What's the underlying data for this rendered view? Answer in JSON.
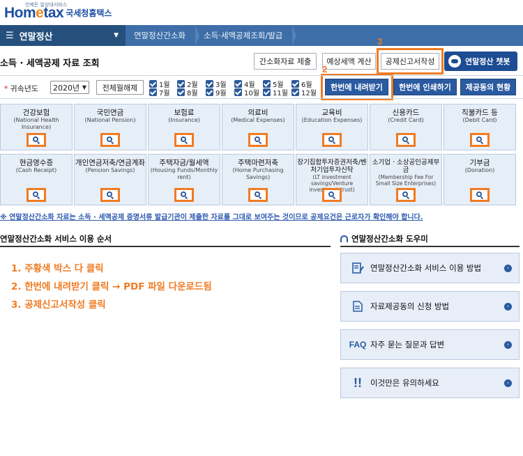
{
  "header": {
    "logo_sub": "언제든 알상대서비스",
    "logo_brand_a": "Hom",
    "logo_brand_e": "e",
    "logo_brand_b": "tax",
    "logo_kr": "국세청홈택스"
  },
  "nav": {
    "menu_label": "연말정산",
    "crumbs": [
      "연말정산간소화",
      "소득·세액공제조회/발급"
    ]
  },
  "page": {
    "title": "소득 · 세액공제 자료 조회",
    "buttons": {
      "simplified_submit": "간소화자료 제출",
      "tax_estimate": "예상세액 계산",
      "deduction_form": "공제신고서작성",
      "chatbot": "연말정산 챗봇"
    }
  },
  "annotations": {
    "n2": "2",
    "n3": "3"
  },
  "filter": {
    "label": "귀속년도",
    "year": "2020년",
    "clear_all": "전체월해제",
    "months": [
      "1월",
      "2월",
      "3월",
      "4월",
      "5월",
      "6월",
      "7월",
      "8월",
      "9월",
      "10월",
      "11월",
      "12월"
    ],
    "download_all": "한번에 내려받기",
    "print_all": "한번에 인쇄하기",
    "provider_status": "제공동의 현황"
  },
  "categories": [
    {
      "name": "건강보험",
      "en": "(National Health Insurance)"
    },
    {
      "name": "국민연금",
      "en": "(National Pension)"
    },
    {
      "name": "보험료",
      "en": "(Insurance)"
    },
    {
      "name": "의료비",
      "en": "(Medical Expenses)"
    },
    {
      "name": "교육비",
      "en": "(Education Expenses)"
    },
    {
      "name": "신용카드",
      "en": "(Credit Card)"
    },
    {
      "name": "직불카드 등",
      "en": "(Debit Card)"
    },
    {
      "name": "현금영수증",
      "en": "(Cash Receipt)"
    },
    {
      "name": "개인연금저축/연금계좌",
      "en": "(Pension Savings)"
    },
    {
      "name": "주택자금/월세액",
      "en": "(Housing Funds/Monthly rent)"
    },
    {
      "name": "주택마련저축",
      "en": "(Home Purchasing Savings)"
    },
    {
      "name": "장기집합투자증권저축/벤처기업투자신탁",
      "en": "(LT investment savings/Venture investment trust)"
    },
    {
      "name": "소기업 · 소상공인공제부금",
      "en": "(Membership Fee For Small Size Enterprises)"
    },
    {
      "name": "기부금",
      "en": "(Donation)"
    }
  ],
  "notice": "※ 연말정산간소화 자료는 소득 · 세액공제 증명서류 발급기관이 제출한 자료를 그대로 보여주는 것이므로 공제요건은 근로자가 확인해야 합니다.",
  "usage": {
    "title": "연말정산간소화 서비스 이용 순서",
    "steps": [
      "1. 주황색 박스 다 클릭",
      "2. 한번에 내려받기 클릭 → PDF 파일 다운로드됨",
      "3. 공제신고서작성 클릭"
    ]
  },
  "helper": {
    "title": "연말정산간소화 도우미",
    "items": [
      {
        "label": "연말정산간소화 서비스 이용 방법",
        "icon": "document-pen-icon"
      },
      {
        "label": "자료제공동의 신청 방법",
        "icon": "document-icon"
      },
      {
        "label": "자주 묻는 질문과 답변",
        "icon": "faq-icon",
        "icon_text": "FAQ"
      },
      {
        "label": "이것만은 유의하세요",
        "icon": "exclamation-icon",
        "icon_text": "!!"
      }
    ]
  },
  "colors": {
    "nav": "#3d6ea8",
    "nav_dark": "#25507e",
    "accent": "#f07b22",
    "tile_bg": "#e6eef8",
    "button_blue": "#2a5aa0"
  }
}
